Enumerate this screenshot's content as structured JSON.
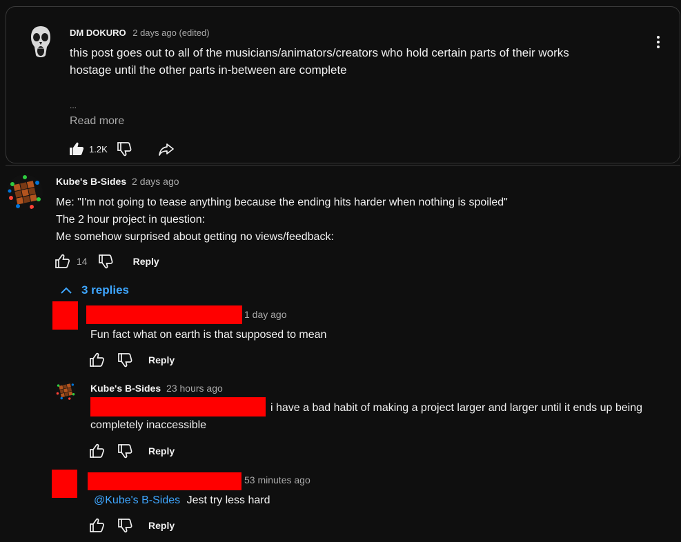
{
  "post": {
    "author": "DM DOKURO",
    "meta": "2 days ago (edited)",
    "body_line1": "this post goes out to all of the musicians/animators/creators who hold certain parts of their works",
    "body_line2": "hostage until the other parts in-between are complete",
    "ellipsis": "...",
    "read_more": "Read more",
    "like_count": "1.2K"
  },
  "comment": {
    "author": "Kube's B-Sides",
    "time": "2 days ago",
    "lines": [
      "Me: \"I'm not going to tease anything because the ending hits harder when nothing is spoiled\"",
      "The 2 hour project in question:",
      "Me somehow surprised about getting no views/feedback:"
    ],
    "like_count": "14",
    "reply_label": "Reply",
    "replies_toggle": "3 replies"
  },
  "replies": [
    {
      "time": "1 day ago",
      "text": "Fun fact what on earth is that supposed to mean",
      "reply_label": "Reply"
    },
    {
      "author": "Kube's B-Sides",
      "time": "23 hours ago",
      "text_line1": "i have a bad habit of making a project larger and larger until it ends up being",
      "text_line2": "completely inaccessible",
      "reply_label": "Reply"
    },
    {
      "time": "53 minutes ago",
      "mention": "@Kube's B-Sides",
      "text": "Jest try less hard",
      "reply_label": "Reply"
    }
  ],
  "colors": {
    "background": "#0f0f0f",
    "link": "#3ea6ff",
    "redaction": "#ff0000",
    "secondary_text": "#aaaaaa"
  }
}
